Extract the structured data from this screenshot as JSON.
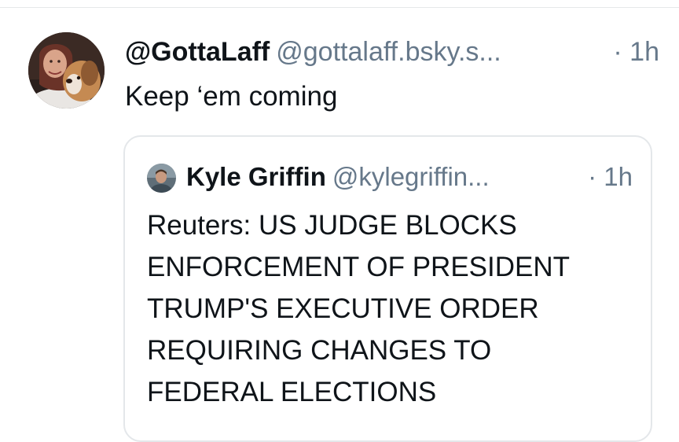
{
  "post": {
    "display_name": "@GottaLaff",
    "handle": "@gottalaff.bsky.s...",
    "time": "· 1h",
    "text": "Keep ‘em coming"
  },
  "quote": {
    "display_name": "Kyle Griffin",
    "handle": "@kylegriffin...",
    "time": "· 1h",
    "text": "Reuters: US JUDGE BLOCKS\nENFORCEMENT OF PRESIDENT\nTRUMP'S EXECUTIVE ORDER\nREQUIRING CHANGES TO\nFEDERAL ELECTIONS"
  },
  "colors": {
    "text": "#0f1419",
    "secondary": "#66788a",
    "border": "#e4e7ea"
  }
}
